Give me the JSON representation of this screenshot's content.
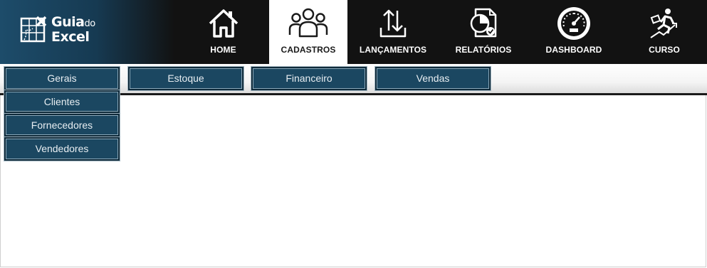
{
  "brand": {
    "line1_bold": "Guia",
    "line1_small": "do",
    "line2": "Excel",
    "icon": "spreadsheet-logo-icon"
  },
  "nav": [
    {
      "label": "HOME",
      "icon": "house-icon",
      "active": false
    },
    {
      "label": "CADASTROS",
      "icon": "people-group-icon",
      "active": true
    },
    {
      "label": "LANÇAMENTOS",
      "icon": "up-down-arrows-icon",
      "active": false
    },
    {
      "label": "RELATÓRIOS",
      "icon": "report-pie-icon",
      "active": false
    },
    {
      "label": "DASHBOARD",
      "icon": "speedometer-icon",
      "active": false
    },
    {
      "label": "CURSO",
      "icon": "running-growth-icon",
      "active": false
    }
  ],
  "submenu": {
    "tabs": [
      "Gerais",
      "Estoque",
      "Financeiro",
      "Vendas"
    ],
    "dropdown": [
      "Clientes",
      "Fornecedores",
      "Vendedores"
    ]
  },
  "colors": {
    "topbar": "#121212",
    "button": "#1b4761",
    "logo_gradient": "#1d4c6a"
  }
}
